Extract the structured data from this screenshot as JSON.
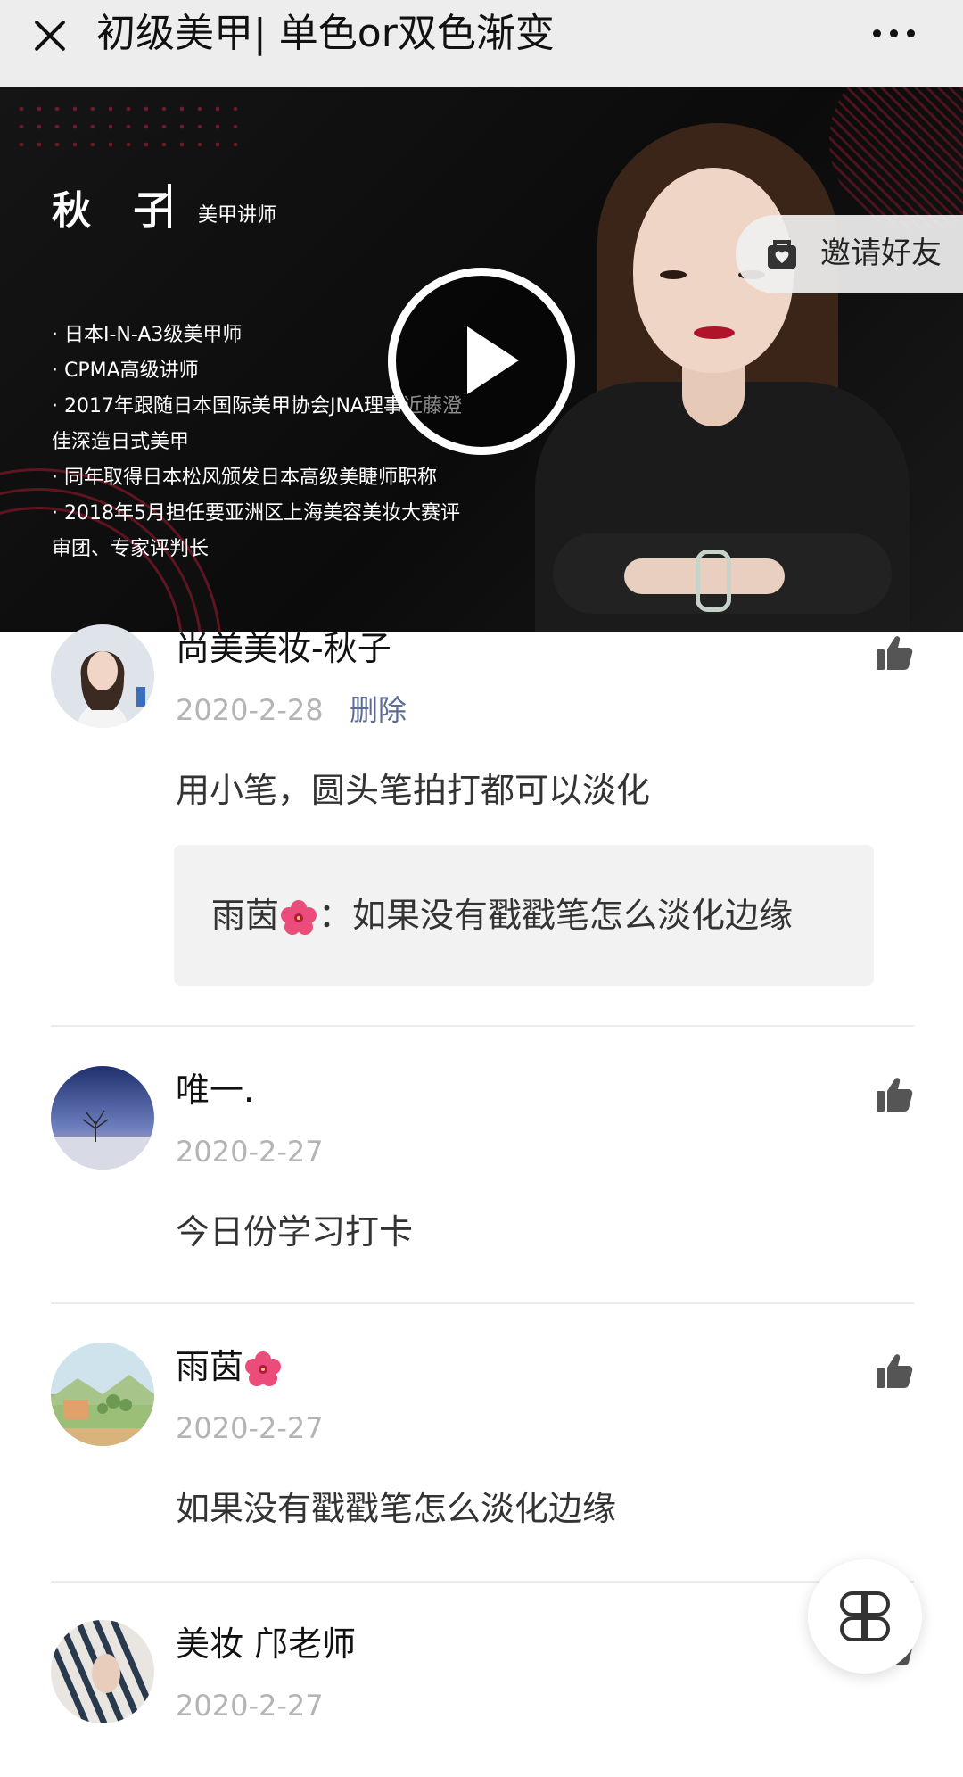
{
  "topbar": {
    "title": "初级美甲| 单色or双色渐变"
  },
  "video": {
    "speaker": {
      "name": "秋 子",
      "role": "美甲讲师"
    },
    "bio": [
      "· 日本I-N-A3级美甲师",
      "· CPMA高级讲师",
      "· 2017年跟随日本国际美甲协会JNA理事近藤澄",
      "佳深造日式美甲",
      "· 同年取得日本松风颁发日本高级美睫师职称",
      "· 2018年5月担任要亚洲区上海美容美妆大赛评",
      "审团、专家评判长"
    ],
    "invite_label": "邀请好友"
  },
  "comments": [
    {
      "name": "尚美美妆-秋子",
      "date": "2020-2-28",
      "delete_label": "删除",
      "text": "用小笔，圆头笔拍打都可以淡化",
      "quote": {
        "author": "雨茵",
        "text": "：如果没有戳戳笔怎么淡化边缘"
      }
    },
    {
      "name": "唯一.",
      "date": "2020-2-27",
      "text": "今日份学习打卡"
    },
    {
      "name": "雨茵",
      "date": "2020-2-27",
      "text": "如果没有戳戳笔怎么淡化边缘"
    },
    {
      "name": "美妆 邝老师",
      "date": "2020-2-27"
    }
  ]
}
